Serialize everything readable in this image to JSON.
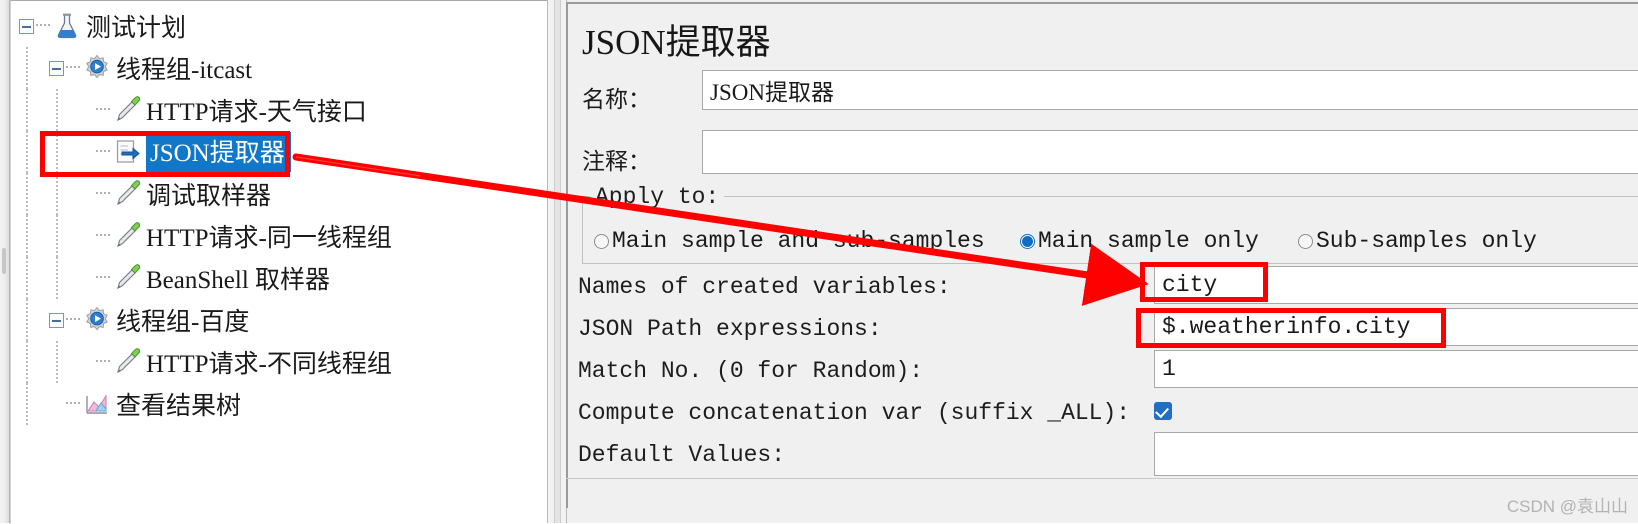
{
  "tree": {
    "nodes": [
      {
        "label": "测试计划",
        "icon": "flask-icon",
        "depth": 0,
        "toggle": "minus",
        "selected": false
      },
      {
        "label": "线程组-itcast",
        "icon": "thread-group-icon",
        "depth": 1,
        "toggle": "minus",
        "selected": false
      },
      {
        "label": "HTTP请求-天气接口",
        "icon": "sampler-icon",
        "depth": 2,
        "toggle": "none",
        "selected": false
      },
      {
        "label": "JSON提取器",
        "icon": "post-processor-icon",
        "depth": 2,
        "toggle": "none",
        "selected": true
      },
      {
        "label": "调试取样器",
        "icon": "sampler-icon",
        "depth": 2,
        "toggle": "none",
        "selected": false
      },
      {
        "label": "HTTP请求-同一线程组",
        "icon": "sampler-icon",
        "depth": 2,
        "toggle": "none",
        "selected": false
      },
      {
        "label": "BeanShell 取样器",
        "icon": "sampler-icon",
        "depth": 2,
        "toggle": "none",
        "selected": false
      },
      {
        "label": "线程组-百度",
        "icon": "thread-group-icon",
        "depth": 1,
        "toggle": "minus",
        "selected": false
      },
      {
        "label": "HTTP请求-不同线程组",
        "icon": "sampler-icon",
        "depth": 2,
        "toggle": "none",
        "selected": false
      },
      {
        "label": "查看结果树",
        "icon": "view-results-tree-icon",
        "depth": 1,
        "toggle": "none",
        "selected": false
      }
    ],
    "selection_color": "#1177c8"
  },
  "form": {
    "title": "JSON提取器",
    "name_label": "名称：",
    "name_value": "JSON提取器",
    "comment_label": "注释：",
    "comment_value": "",
    "apply_to": {
      "group_title": "Apply to:",
      "options": [
        {
          "label": "Main sample and sub-samples",
          "selected": false
        },
        {
          "label": "Main sample only",
          "selected": true
        },
        {
          "label": "Sub-samples only",
          "selected": false
        }
      ]
    },
    "variables_label": "Names of created variables:",
    "variables_value": "city",
    "jsonpath_label": "JSON Path expressions:",
    "jsonpath_value": "$.weatherinfo.city",
    "matchno_label": "Match No. (0 for Random):",
    "matchno_value": "1",
    "concat_label": "Compute concatenation var (suffix _ALL):",
    "concat_checked": true,
    "default_label": "Default Values:",
    "default_value": ""
  },
  "annotations": {
    "highlight_color": "#ff0000",
    "boxes": [
      "tree-selected-node",
      "variables-input",
      "jsonpath-input"
    ],
    "arrow": "points from tree JSON提取器 node to variables input"
  },
  "watermark": {
    "text": "CSDN @袁山山"
  }
}
